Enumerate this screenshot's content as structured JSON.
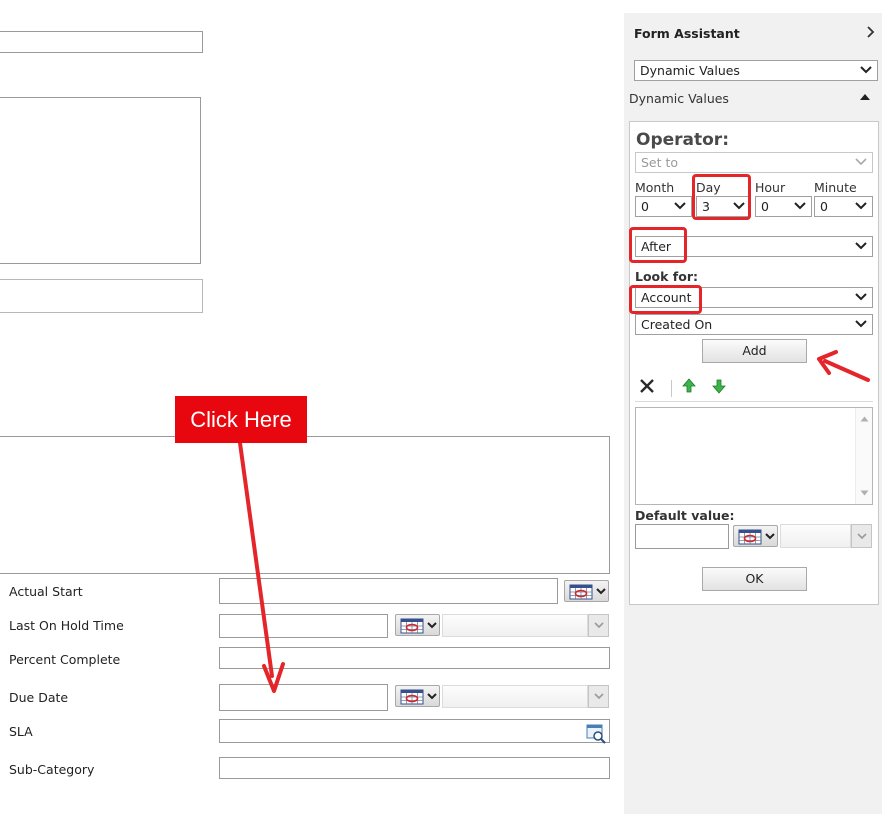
{
  "form": {
    "rows": [
      {
        "label": "Actual Start"
      },
      {
        "label": "Last On Hold Time"
      },
      {
        "label": "Percent Complete"
      },
      {
        "label": "Due Date"
      },
      {
        "label": "SLA"
      },
      {
        "label": "Sub-Category"
      }
    ]
  },
  "callout": {
    "text": "Click Here"
  },
  "assistant": {
    "title": "Form Assistant",
    "mode_select": "Dynamic Values",
    "section_title": "Dynamic Values",
    "operator_label": "Operator:",
    "operator_value": "Set to",
    "time": {
      "month_label": "Month",
      "month_value": "0",
      "day_label": "Day",
      "day_value": "3",
      "hour_label": "Hour",
      "hour_value": "0",
      "minute_label": "Minute",
      "minute_value": "0"
    },
    "relation_value": "After",
    "lookfor_label": "Look for:",
    "lookfor_entity": "Account",
    "lookfor_field": "Created On",
    "add_label": "Add",
    "default_label": "Default value:",
    "ok_label": "OK"
  },
  "colors": {
    "annotation_red": "#e4262b",
    "panel_bg": "#f1f1f1"
  }
}
